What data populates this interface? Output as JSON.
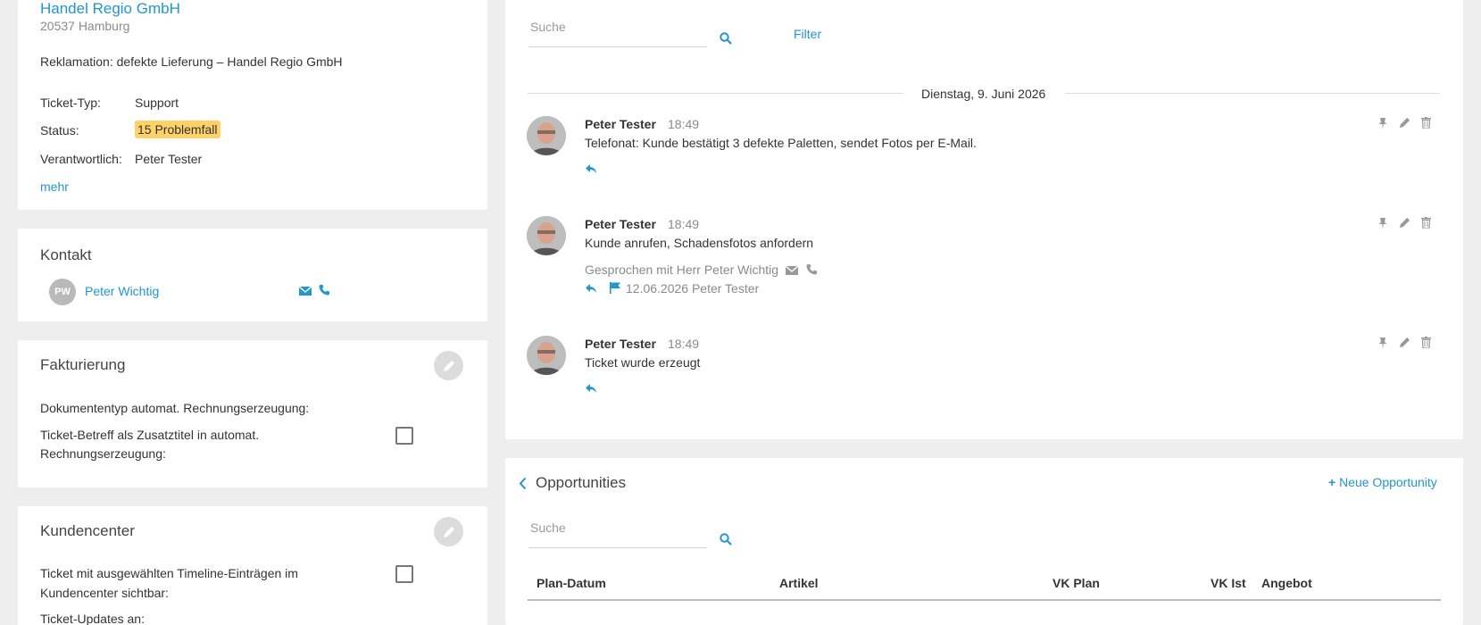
{
  "ticket": {
    "company": "Handel Regio GmbH",
    "address": "20537 Hamburg",
    "subject": "Reklamation: defekte Lieferung – Handel Regio GmbH",
    "type_label": "Ticket-Typ:",
    "type_value": "Support",
    "status_label": "Status:",
    "status_value": "15 Problemfall",
    "owner_label": "Verantwortlich:",
    "owner_value": "Peter Tester",
    "more_link": "mehr",
    "status_color": "#ffd166"
  },
  "contact": {
    "title": "Kontakt",
    "initials": "PW",
    "name": "Peter Wichtig"
  },
  "billing": {
    "title": "Fakturierung",
    "doc_type_label": "Dokumententyp automat. Rechnungserzeugung:",
    "subject_label_line1": "Ticket-Betreff als Zusatztitel in automat.",
    "subject_label_line2": "Rechnungserzeugung:"
  },
  "customer_center": {
    "title": "Kundencenter",
    "visible_label_line1": "Ticket mit ausgewählten Timeline-Einträgen im",
    "visible_label_line2": "Kundencenter sichtbar:",
    "updates_label": "Ticket-Updates an:"
  },
  "timeline": {
    "search_placeholder": "Suche",
    "filter_label": "Filter",
    "date_label": "Dienstag, 9. Juni 2026",
    "entries": [
      {
        "author": "Peter Tester",
        "time": "18:49",
        "text": "Telefonat: Kunde bestätigt 3 defekte Paletten, sendet Fotos per E-Mail."
      },
      {
        "author": "Peter Tester",
        "time": "18:49",
        "text": "Kunde anrufen, Schadensfotos anfordern",
        "spoken_with": "Gesprochen mit Herr Peter Wichtig",
        "due": "12.06.2026 Peter Tester"
      },
      {
        "author": "Peter Tester",
        "time": "18:49",
        "text": "Ticket wurde erzeugt"
      }
    ]
  },
  "opportunities": {
    "title": "Opportunities",
    "new_button": "Neue Opportunity",
    "search_placeholder": "Suche",
    "columns": [
      "Plan-Datum",
      "Artikel",
      "VK Plan",
      "VK Ist",
      "Angebot"
    ]
  },
  "colors": {
    "accent": "#2196cf",
    "background": "#eeeeef"
  }
}
